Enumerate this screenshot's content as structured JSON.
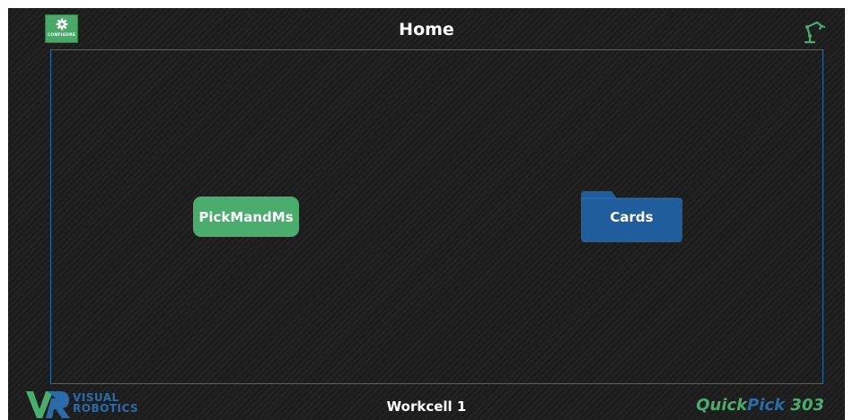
{
  "header": {
    "title": "Home",
    "configure_label": "CONFIGURE"
  },
  "workspace": {
    "program": {
      "label": "PickMandMs"
    },
    "folder": {
      "label": "Cards"
    }
  },
  "footer": {
    "logo_line1": "VISUAL",
    "logo_line2": "ROBOTICS",
    "workcell": "Workcell 1",
    "brand_part1": "Quick",
    "brand_part2": "Pick",
    "brand_part3": " 303"
  },
  "colors": {
    "background": "#1f1f1f",
    "accent_green": "#4aac6d",
    "accent_blue": "#2a6ba8",
    "text": "#ffffff"
  },
  "icons": {
    "configure": "gear-icon",
    "robot": "robot-arm-icon",
    "folder": "folder-icon",
    "logo": "vr-logo-icon"
  }
}
